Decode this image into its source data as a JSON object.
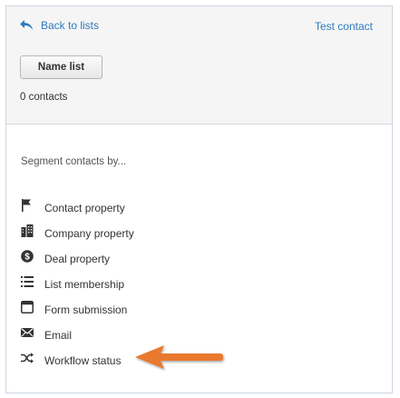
{
  "header": {
    "back_label": "Back to lists",
    "test_contact_label": "Test contact",
    "name_list_label": "Name list",
    "contacts_count": "0 contacts"
  },
  "segment": {
    "title": "Segment contacts by...",
    "options": [
      {
        "label": "Contact property",
        "icon": "flag-icon"
      },
      {
        "label": "Company property",
        "icon": "building-icon"
      },
      {
        "label": "Deal property",
        "icon": "dollar-icon"
      },
      {
        "label": "List membership",
        "icon": "list-icon"
      },
      {
        "label": "Form submission",
        "icon": "form-icon"
      },
      {
        "label": "Email",
        "icon": "envelope-icon"
      },
      {
        "label": "Workflow status",
        "icon": "shuffle-icon"
      }
    ]
  },
  "colors": {
    "link": "#2e7abf",
    "arrow": "#e8792f",
    "panel_border": "#cbd6e2"
  }
}
